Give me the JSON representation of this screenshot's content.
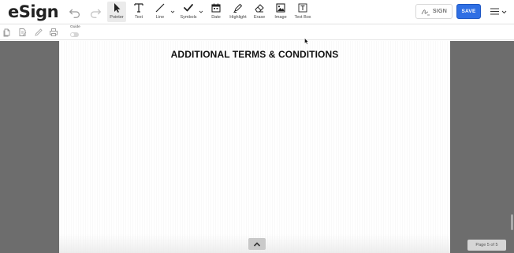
{
  "app": {
    "logo": "eSign",
    "trademark": "™"
  },
  "toolbar": {
    "tools": [
      {
        "label": "Pointer",
        "icon": "pointer-icon",
        "active": true
      },
      {
        "label": "Text",
        "icon": "text-icon"
      },
      {
        "label": "Line",
        "icon": "line-icon"
      },
      {
        "label": "Symbols",
        "icon": "checkmark-icon"
      },
      {
        "label": "Date",
        "icon": "calendar-icon"
      },
      {
        "label": "Highlight",
        "icon": "highlighter-icon"
      },
      {
        "label": "Erase",
        "icon": "eraser-icon"
      },
      {
        "label": "Image",
        "icon": "image-icon"
      },
      {
        "label": "Text Box",
        "icon": "textbox-icon"
      }
    ],
    "sign_label": "SIGN",
    "save_label": "SAVE"
  },
  "subbar": {
    "guide_label": "Guide",
    "guide_on": false
  },
  "document": {
    "title": "ADDITIONAL TERMS & CONDITIONS",
    "page_indicator": "Page 5 of 5"
  },
  "colors": {
    "accent": "#2f6fe4",
    "workspace": "#6d6d6d"
  }
}
